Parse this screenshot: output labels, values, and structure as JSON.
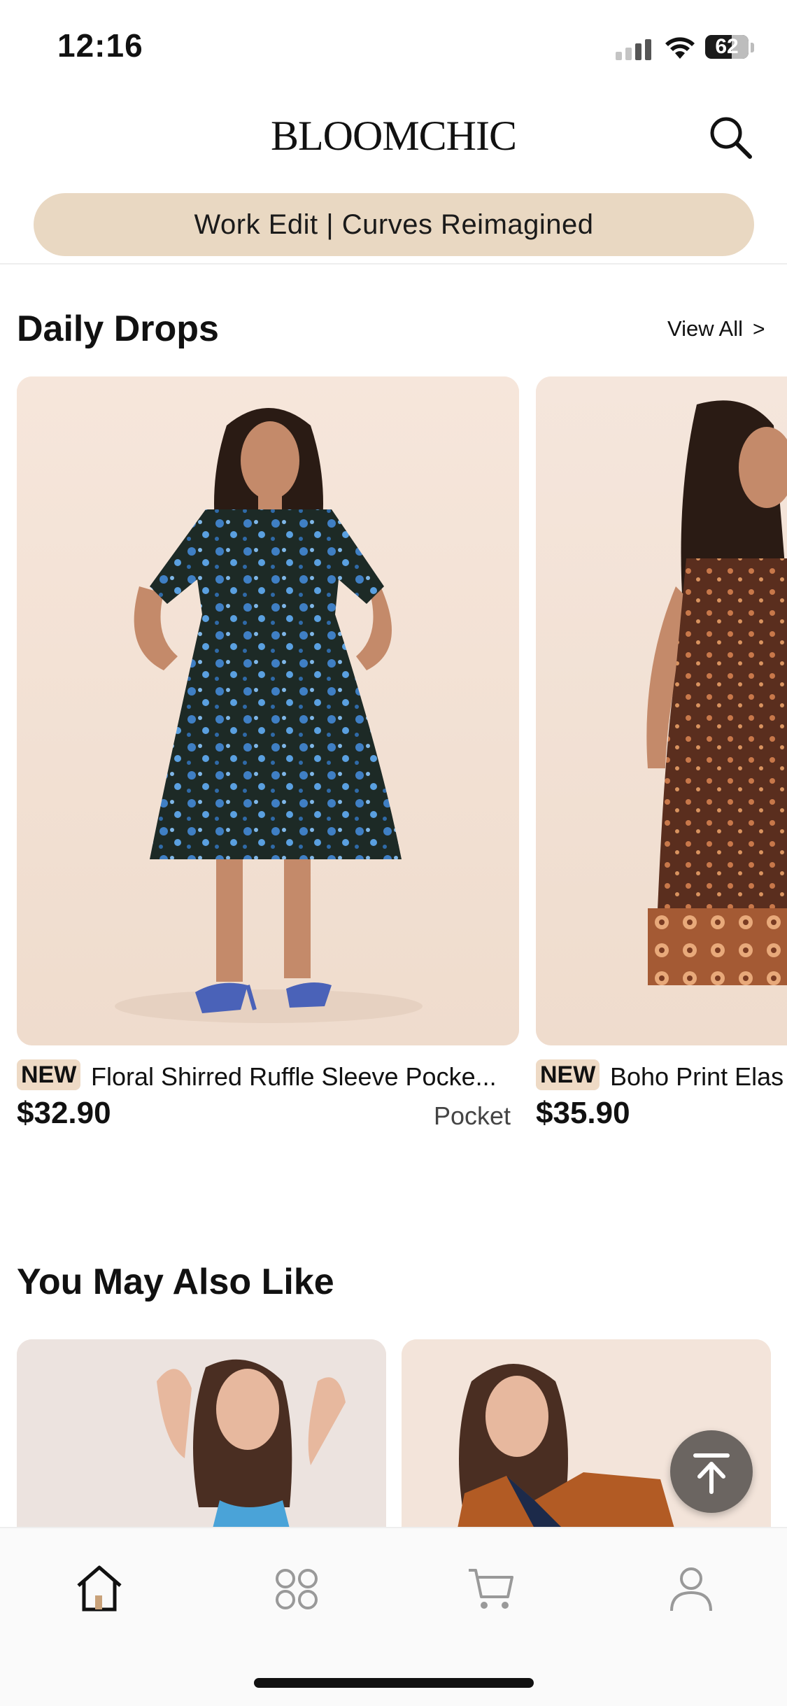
{
  "status_bar": {
    "time": "12:16",
    "battery": "62",
    "battery_level": 0.62
  },
  "header": {
    "brand": "BLOOMCHIC",
    "search_icon": "search-icon"
  },
  "promo": {
    "text": "Work Edit | Curves Reimagined",
    "color": "#e9d8c2"
  },
  "daily_drops": {
    "title": "Daily Drops",
    "view_all": "View All",
    "products": [
      {
        "badge": "NEW",
        "name": "Floral Shirred Ruffle Sleeve Pocke...",
        "price": "$32.90",
        "tag": "Pocket"
      },
      {
        "badge": "NEW",
        "name": "Boho Print Elas",
        "price": "$35.90",
        "tag": ""
      }
    ]
  },
  "recommendations": {
    "title": "You May Also Like"
  },
  "tabbar": {
    "items": [
      {
        "icon": "home-icon",
        "active": true
      },
      {
        "icon": "categories-icon",
        "active": false
      },
      {
        "icon": "cart-icon",
        "active": false
      },
      {
        "icon": "account-icon",
        "active": false
      }
    ]
  },
  "colors": {
    "accent": "#e9d8c2",
    "badge": "#eedac5",
    "fab": "#6b6561"
  }
}
